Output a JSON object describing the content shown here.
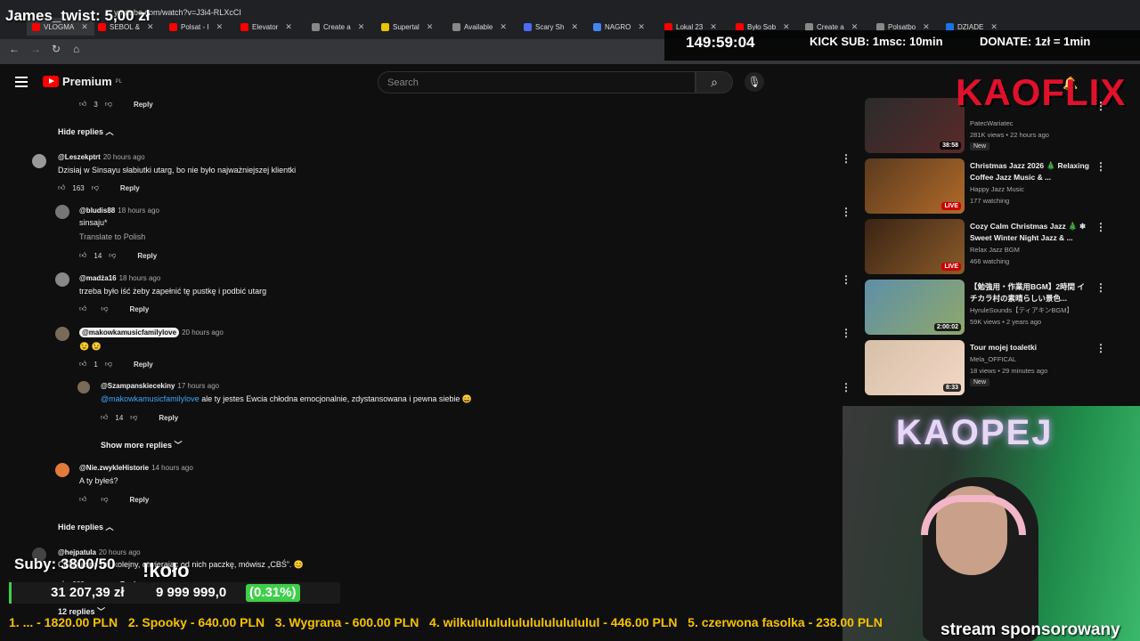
{
  "stream": {
    "top_left": "James_twist: 5,00 zł",
    "timer": "149:59:04",
    "kick_sub": "KICK SUB: 1msc: 10min",
    "donate": "DONATE: 1zł = 1min",
    "brand": "KAOFLIX",
    "subs_label": "Suby: 3800/50",
    "koto": "!koło",
    "amount_left": "31 207,39 zł",
    "amount_goal": "9 999 999,0",
    "pct": "(0.31%)",
    "ticker": "1. ... - 1820.00 PLN   2. Spooky - 640.00 PLN   3. Wygrana - 600.00 PLN   4. wilkulululululululululululul - 446.00 PLN   5. czerwona fasolka - 238.00 PLN",
    "sponsor": "stream sponsorowany",
    "neon": "KAOPEJ"
  },
  "tabs": [
    "VLOGMA",
    "SEBOL &",
    "Polsat - I",
    "Elevator",
    "Create a",
    "Supertal",
    "Available",
    "Scary Sh",
    "NAGRO",
    "Lokal 23",
    "Było Sob",
    "Create a",
    "Polsatbo",
    "DZIADE"
  ],
  "address": "youtube.com/watch?v=J3i4-RLXcCI",
  "yt": {
    "logo": "Premium",
    "region": "PL",
    "search_placeholder": "Search"
  },
  "comments": [
    {
      "handle": "",
      "time": "",
      "text": "",
      "likes": "3",
      "reply": "Reply"
    },
    {
      "handle": "@Leszekptrt",
      "time": "20 hours ago",
      "text": "Dzisiaj w Sinsayu słabiutki utarg, bo nie było najważniejszej klientki",
      "likes": "163",
      "reply": "Reply"
    },
    {
      "handle": "@bludis88",
      "time": "18 hours ago",
      "text": "sinsaju*",
      "translate": "Translate to Polish",
      "likes": "14",
      "reply": "Reply"
    },
    {
      "handle": "@madża16",
      "time": "18 hours ago",
      "text": "trzeba było iść żeby zapełnić tę pustkę i podbić utarg",
      "likes": "",
      "reply": "Reply"
    },
    {
      "handle": "@makowkamusicfamilylove",
      "time": "20 hours ago",
      "text": "😉 😉",
      "likes": "1",
      "reply": "Reply"
    },
    {
      "handle": "@Szampanskiecekiny",
      "time": "17 hours ago",
      "mention": "@makowkamusicfamilylove",
      "text": "ale ty jestes Ewcia chłodna emocjonalnie, zdystansowana i pewna siebie 😄",
      "likes": "14",
      "reply": "Reply"
    },
    {
      "handle": "@Nie.zwykleHistorie",
      "time": "14 hours ago",
      "text": "A ty byłeś?",
      "likes": "",
      "reply": "Reply"
    },
    {
      "handle": "@hejpatula",
      "time": "20 hours ago",
      "text": "CBS już po raz kolejny, otwierając od nich paczkę, mówisz „CBŚ”. 😊",
      "likes": "223",
      "reply": "Reply"
    }
  ],
  "hide_replies": "Hide replies",
  "show_more": "Show more replies",
  "twelve_replies": "12 replies",
  "sidebar": [
    {
      "title": "",
      "channel": "PatecWariatec",
      "meta": "281K views • 22 hours ago",
      "badge": "New",
      "dur": "38:58"
    },
    {
      "title": "Christmas Jazz 2026 🎄 Relaxing Coffee Jazz Music & ...",
      "channel": "Happy Jazz Music",
      "meta": "177 watching",
      "live": "LIVE"
    },
    {
      "title": "Cozy Calm Christmas Jazz 🎄 ❄ Sweet Winter Night Jazz & ...",
      "channel": "Relax Jazz BGM",
      "meta": "466 watching",
      "live": "LIVE"
    },
    {
      "title": "【勉強用・作業用BGM】2時間 イチカラ村の素晴らしい景色...",
      "channel": "HyruleSounds【ティアキンBGM】",
      "meta": "59K views • 2 years ago",
      "dur": "2:00:02"
    },
    {
      "title": "Tour mojej toaletki",
      "channel": "Mela_OFFICAL",
      "meta": "18 views • 29 minutes ago",
      "badge": "New",
      "dur": "8:33"
    }
  ]
}
